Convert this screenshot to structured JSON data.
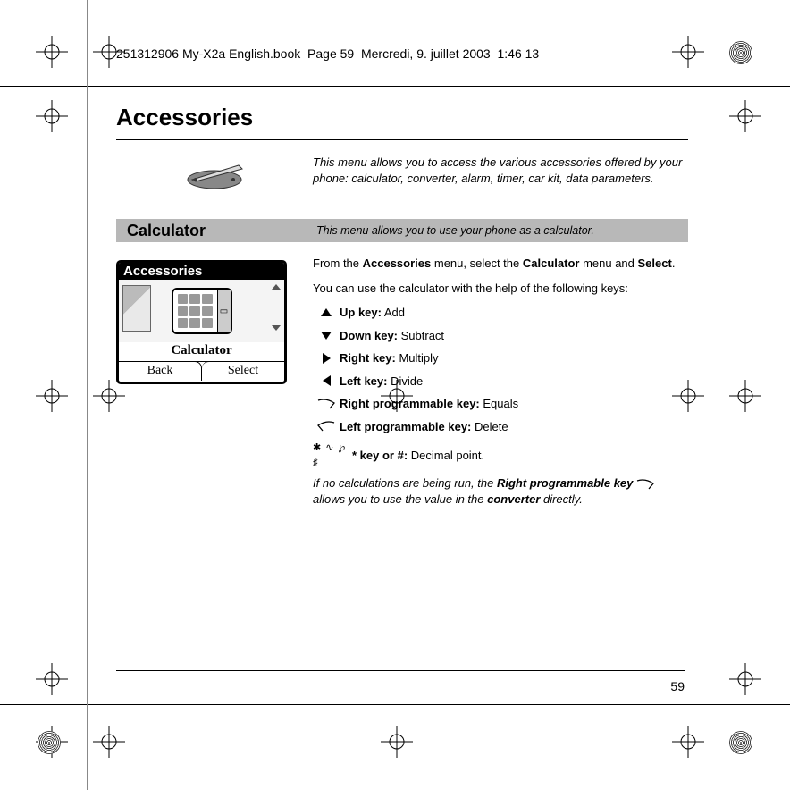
{
  "header_stamp": "251312906 My-X2a English.book  Page 59  Mercredi, 9. juillet 2003  1:46 13",
  "title": "Accessories",
  "intro": "This menu allows you to access the various accessories offered by your phone: calculator, converter, alarm, timer, car kit, data parameters.",
  "section": {
    "title": "Calculator",
    "desc": "This menu allows you to use your phone as a calculator."
  },
  "body": {
    "p1_a": "From the ",
    "p1_b": "Accessories",
    "p1_c": " menu, select the ",
    "p1_d": "Calculator",
    "p1_e": " menu and ",
    "p1_f": "Select",
    "p1_g": ".",
    "p2": "You can use the calculator with the help of the following keys:"
  },
  "keys": {
    "up_b": "Up key:",
    "up": " Add",
    "down_b": "Down key:",
    "down": " Subtract",
    "right_b": "Right key:",
    "right": " Multiply",
    "left_b": "Left key:",
    "left": " Divide",
    "rp_b": "Right programmable key:",
    "rp": " Equals",
    "lp_b": "Left programmable key:",
    "lp": " Delete",
    "star_sym": "✱ ∿ ℘ ♯",
    "star_b": "* key or #:",
    "star": " Decimal point."
  },
  "note": {
    "a": "If no calculations are being run, the ",
    "b": "Right programmable key",
    "c": " allows you to use the value in the ",
    "d": "converter",
    "e": " directly."
  },
  "phone": {
    "title": "Accessories",
    "label": "Calculator",
    "back": "Back",
    "select": "Select"
  },
  "page_number": "59"
}
